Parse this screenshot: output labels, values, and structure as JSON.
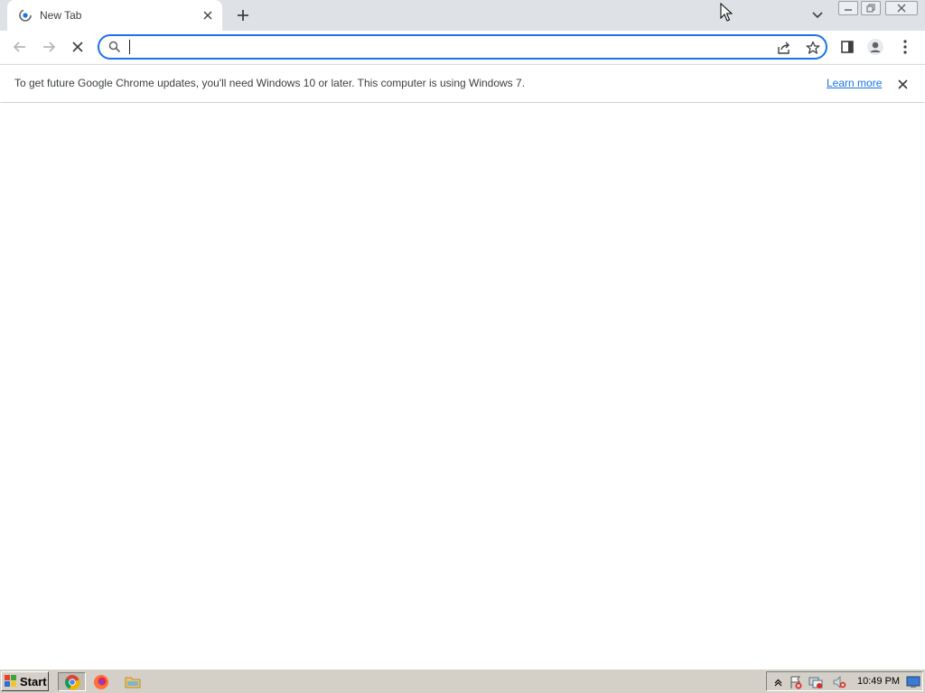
{
  "browser": {
    "tab": {
      "title": "New Tab",
      "favicon": "chrome-loading-icon",
      "close_icon": "close-icon"
    },
    "new_tab_icon": "plus-icon",
    "tab_search_icon": "chevron-down-icon",
    "window_controls": [
      "minimize-icon",
      "restore-icon",
      "close-icon"
    ]
  },
  "toolbar": {
    "back_icon": "arrow-left-icon",
    "forward_icon": "arrow-right-icon",
    "stop_icon": "close-icon",
    "omnibox": {
      "value": "",
      "placeholder": "",
      "search_icon": "search-icon",
      "share_icon": "share-icon",
      "bookmark_icon": "star-icon"
    },
    "side_panel_icon": "side-panel-icon",
    "profile_icon": "person-icon",
    "menu_icon": "kebab-menu-icon",
    "accent_color": "#1a73e8"
  },
  "infobar": {
    "message": "To get future Google Chrome updates, you'll need Windows 10 or later. This computer is using Windows 7.",
    "link_label": "Learn more",
    "close_icon": "close-icon",
    "link_color": "#1a73e8"
  },
  "taskbar": {
    "start_label": "Start",
    "apps": [
      "chrome-icon",
      "firefox-icon",
      "file-explorer-icon"
    ],
    "tray_icons": [
      "tray-expand-icon",
      "action-center-icon",
      "network-icon",
      "volume-muted-icon",
      "show-desktop-icon"
    ],
    "clock": "10:49 PM"
  }
}
